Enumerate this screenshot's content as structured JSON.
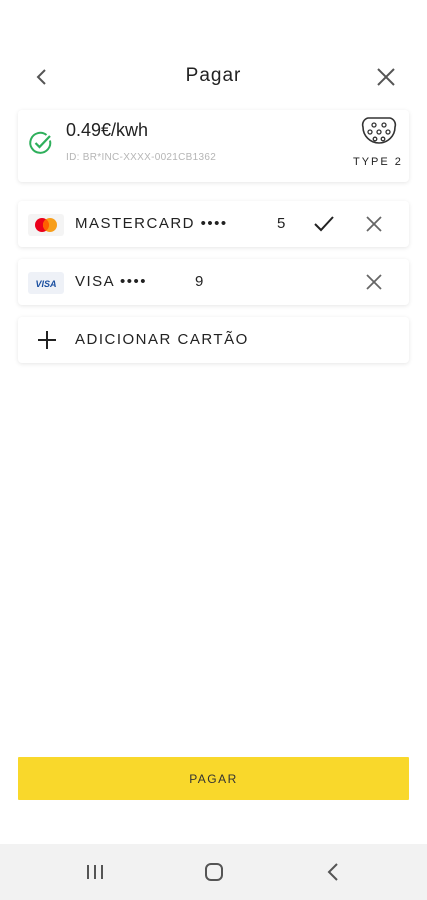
{
  "header": {
    "title": "Pagar"
  },
  "charger": {
    "price": "0.49€/kwh",
    "id": "ID: BR*INC-XXXX-0021CB1362",
    "connector_type": "TYPE 2"
  },
  "payment_methods": [
    {
      "brand": "MASTERCARD",
      "label": "MASTERCARD ••••",
      "last_digit": "5",
      "selected": true
    },
    {
      "brand": "VISA",
      "label": "VISA ••••",
      "last_digit": "9",
      "selected": false,
      "brand_logo_text": "VISA"
    }
  ],
  "add_card": {
    "label": "ADICIONAR CARTÃO"
  },
  "pay_button": {
    "label": "PAGAR",
    "color": "#F9D82B"
  },
  "colors": {
    "success": "#2EAF5B",
    "mastercard_red": "#EB001B",
    "mastercard_orange": "#F79E1B",
    "visa_blue": "#1A4FA0"
  },
  "icons": [
    "back-arrow-icon",
    "close-icon",
    "check-circle-icon",
    "type2-connector-icon",
    "checkmark-icon",
    "remove-icon",
    "plus-icon"
  ]
}
